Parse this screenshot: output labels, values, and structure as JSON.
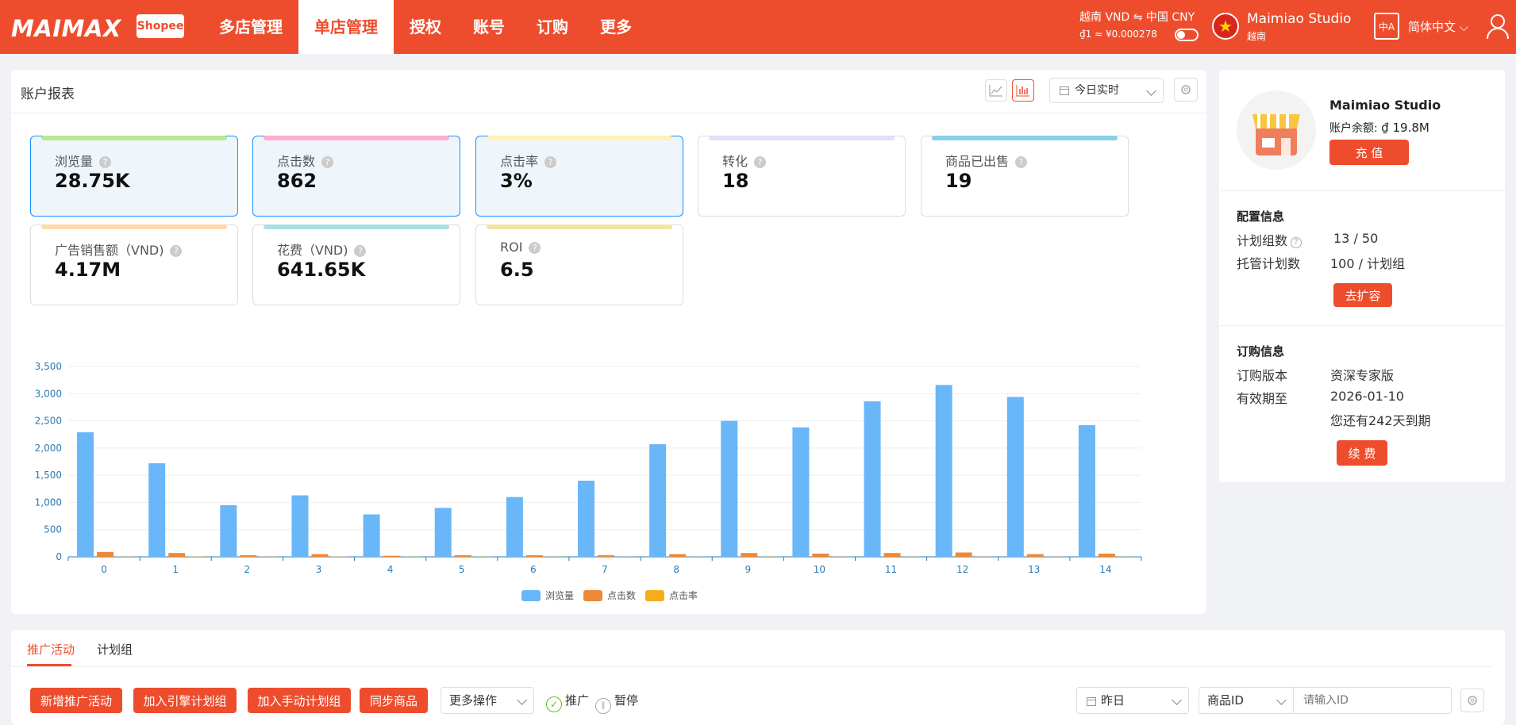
{
  "header": {
    "logo": "MAIMAX",
    "logo_badge": "Shopee",
    "nav": [
      "多店管理",
      "单店管理",
      "授权",
      "账号",
      "订购",
      "更多"
    ],
    "currency_line1": "越南 VND  ⇋  中国 CNY",
    "currency_line2": "₫1 ≈ ¥0.000278",
    "shop_name": "Maimiao Studio",
    "shop_region": "越南",
    "lang_icon": "中A",
    "language": "简体中文"
  },
  "report": {
    "title": "账户报表",
    "date_range": "今日实时",
    "metrics": [
      {
        "label": "浏览量",
        "value": "28.75K",
        "color": "#b7eb8f",
        "selected": true
      },
      {
        "label": "点击数",
        "value": "862",
        "color": "#ffadd2",
        "selected": true
      },
      {
        "label": "点击率",
        "value": "3%",
        "color": "#fff1b8",
        "selected": true
      },
      {
        "label": "转化",
        "value": "18",
        "color": "#e0e0f5",
        "selected": false
      },
      {
        "label": "商品已出售",
        "value": "19",
        "color": "#87cfe8",
        "selected": false
      },
      {
        "label": "广告销售额（VND)",
        "value": "4.17M",
        "color": "#ffd8b0",
        "selected": false
      },
      {
        "label": "花费（VND)",
        "value": "641.65K",
        "color": "#a8e0e0",
        "selected": false
      },
      {
        "label": "ROI",
        "value": "6.5",
        "color": "#f3e3a3",
        "selected": false
      }
    ]
  },
  "chart_data": {
    "type": "bar",
    "categories": [
      "0",
      "1",
      "2",
      "3",
      "4",
      "5",
      "6",
      "7",
      "8",
      "9",
      "10",
      "11",
      "12",
      "13",
      "14"
    ],
    "series": [
      {
        "name": "浏览量",
        "color": "#69b6f9",
        "values": [
          2290,
          1720,
          950,
          1130,
          780,
          900,
          1100,
          1400,
          2070,
          2500,
          2380,
          2860,
          3160,
          2940,
          2420
        ]
      },
      {
        "name": "点击数",
        "color": "#ed8936",
        "values": [
          90,
          70,
          30,
          50,
          20,
          30,
          30,
          30,
          50,
          70,
          60,
          70,
          80,
          50,
          60
        ]
      },
      {
        "name": "点击率",
        "color": "#f6ad1c",
        "values": [
          3,
          4,
          3,
          4,
          3,
          3,
          3,
          2,
          2,
          3,
          3,
          2,
          3,
          2,
          2
        ]
      }
    ],
    "yticks": [
      "0",
      "500",
      "1,000",
      "1,500",
      "2,000",
      "2,500",
      "3,000",
      "3,500"
    ],
    "ylim": [
      0,
      3500
    ],
    "legend": "bottom"
  },
  "account": {
    "name": "Maimiao Studio",
    "balance_label": "账户余额:",
    "balance": "₫ 19.8M",
    "recharge": "充 值",
    "config_title": "配置信息",
    "plan_groups_label": "计划组数",
    "plan_groups_value": "13 / 50",
    "managed_label": "托管计划数",
    "managed_value": "100 / 计划组",
    "expand": "去扩容",
    "order_title": "订购信息",
    "version_label": "订购版本",
    "version_value": "资深专家版",
    "expiry_label": "有效期至",
    "expiry_value": "2026-01-10",
    "remaining": "您还有242天到期",
    "renew": "续 费"
  },
  "bottom": {
    "tabs": [
      "推广活动",
      "计划组"
    ],
    "buttons": [
      "新增推广活动",
      "加入引擎计划组",
      "加入手动计划组",
      "同步商品"
    ],
    "more_ops": "更多操作",
    "promote": "推广",
    "pause": "暂停",
    "date": "昨日",
    "field": "商品ID",
    "placeholder": "请输入ID"
  }
}
